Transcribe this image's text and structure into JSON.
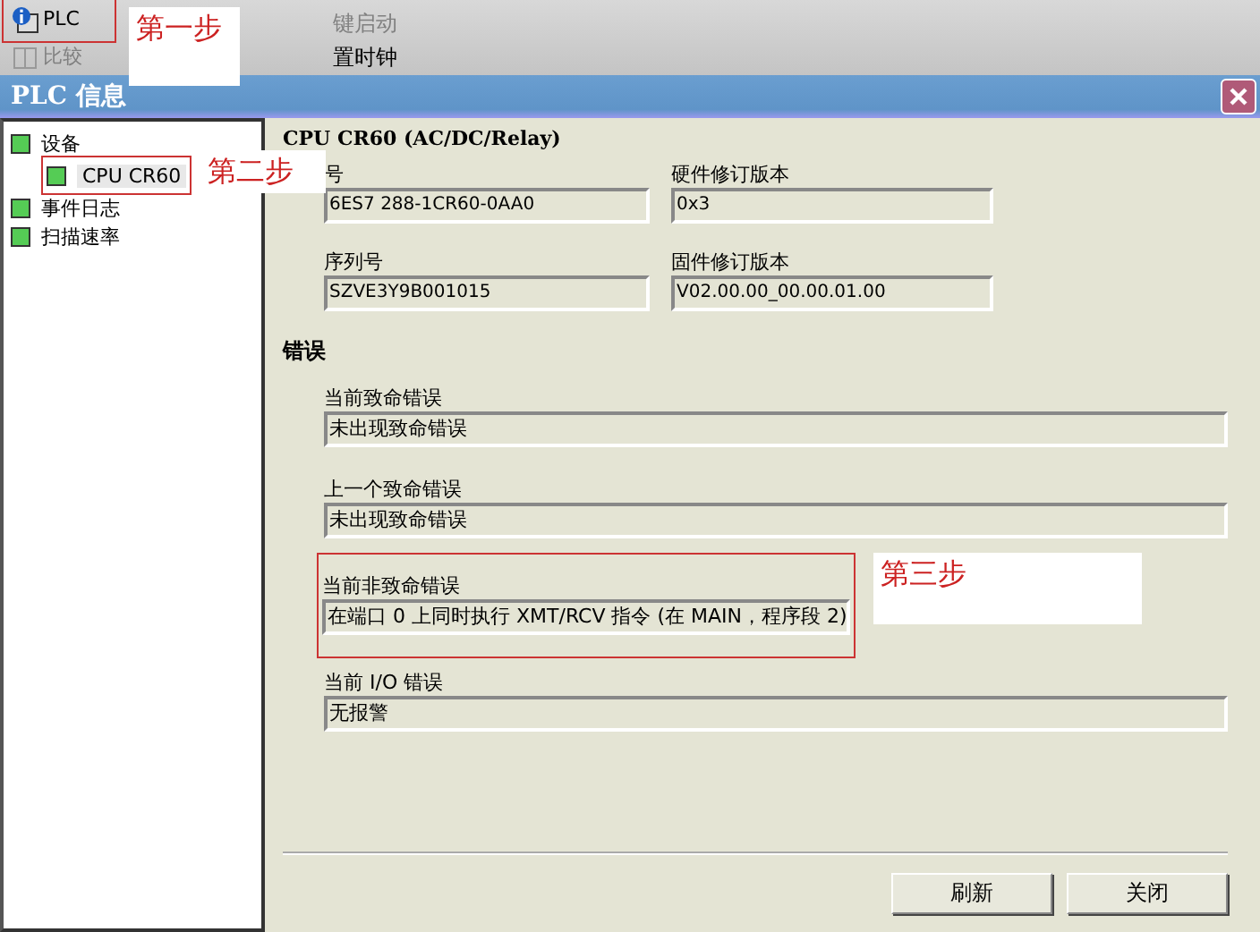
{
  "toolbar": {
    "buttons": [
      {
        "label": "PLC",
        "disabled": false,
        "annotated": true
      },
      {
        "label": "比较",
        "disabled": true
      },
      {
        "label": "键启动",
        "disabled": true
      },
      {
        "label": "置时钟",
        "disabled": false
      }
    ]
  },
  "window": {
    "title": "PLC 信息"
  },
  "tree": {
    "items": [
      {
        "label": "设备",
        "children": [
          {
            "label": "CPU CR60",
            "selected": true,
            "annotated": true
          }
        ],
        "selected": false
      },
      {
        "label": "事件日志",
        "selected": false
      },
      {
        "label": "扫描速率",
        "selected": false
      }
    ]
  },
  "device": {
    "heading": "CPU CR60 (AC/DC/Relay)",
    "fields": [
      {
        "label": "号",
        "value": "6ES7 288-1CR60-0AA0"
      },
      {
        "label": "硬件修订版本",
        "value": "0x3"
      },
      {
        "label": "序列号",
        "value": "SZVE3Y9B001015"
      },
      {
        "label": "固件修订版本",
        "value": "V02.00.00_00.00.01.00"
      }
    ]
  },
  "errors": {
    "heading": "错误",
    "fields": [
      {
        "label": "当前致命错误",
        "value": "未出现致命错误"
      },
      {
        "label": "上一个致命错误",
        "value": "未出现致命错误"
      },
      {
        "label": "当前非致命错误",
        "value": "在端口 0 上同时执行 XMT/RCV 指令 (在 MAIN，程序段 2)",
        "annotated": true
      },
      {
        "label": "当前 I/O 错误",
        "value": "无报警"
      }
    ]
  },
  "buttons": [
    "刷新",
    "关闭"
  ],
  "annotations": [
    "第一步",
    "第二步",
    "第三步"
  ]
}
